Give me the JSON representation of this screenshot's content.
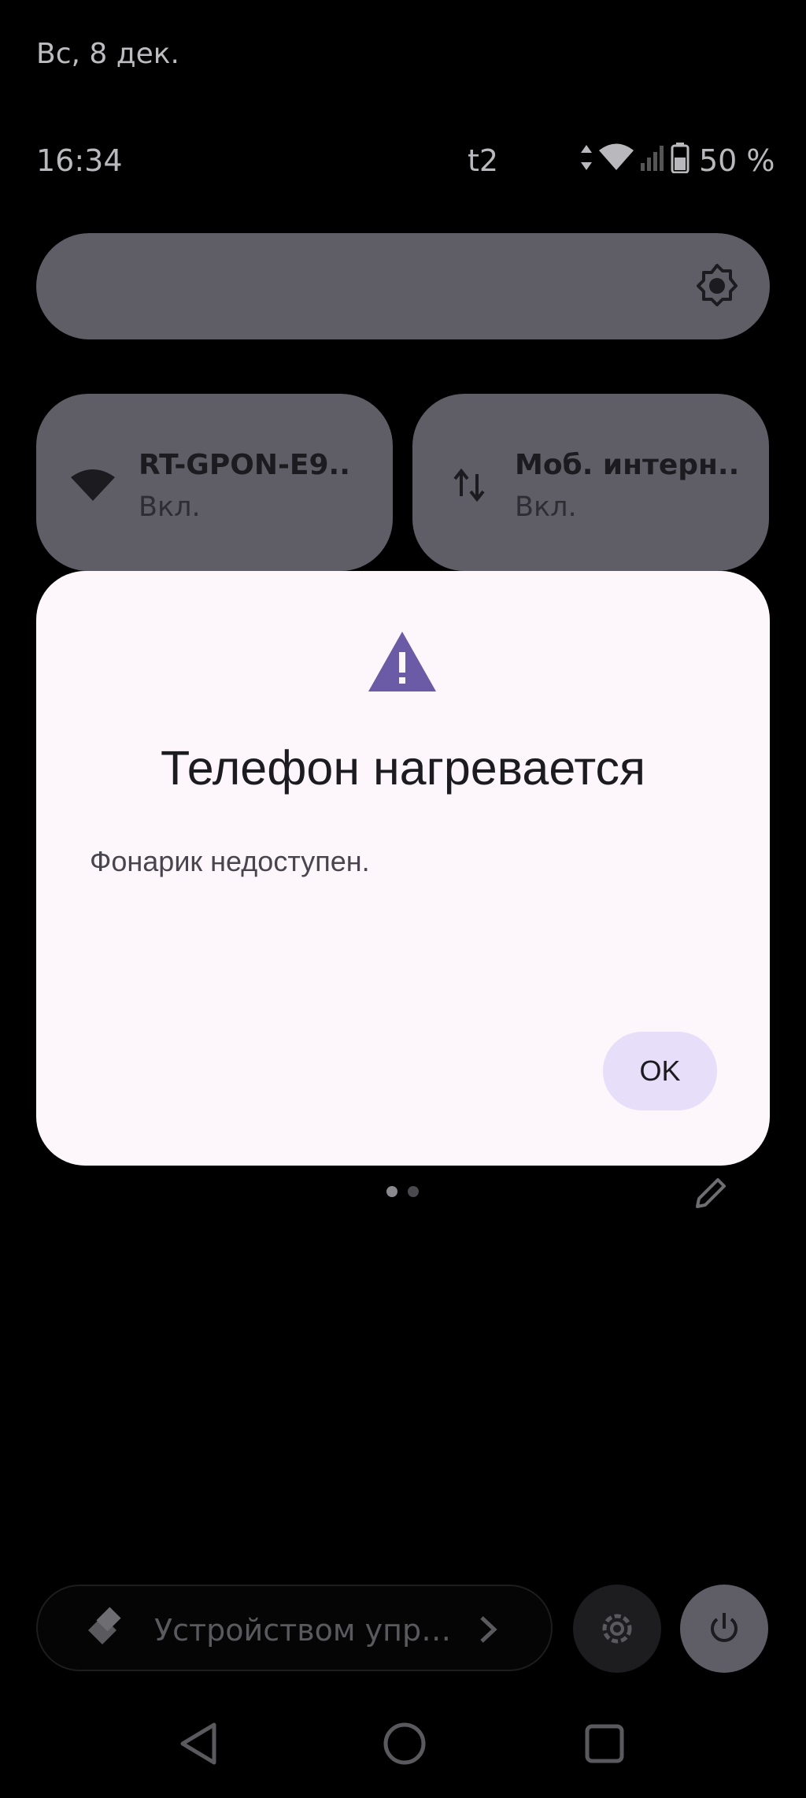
{
  "status_bar": {
    "date": "Вс, 8 дек.",
    "time": "16:34",
    "carrier": "t2",
    "battery": "50 %",
    "icons": [
      "data-arrows-icon",
      "wifi-icon",
      "cellular-signal-icon",
      "battery-icon"
    ]
  },
  "quick_settings": {
    "brightness_icon": "brightness-icon",
    "tiles": [
      {
        "title": "RT-GPON-E9..",
        "status": "Вкл.",
        "icon": "wifi-icon"
      },
      {
        "title": "Моб. интерн..",
        "status": "Вкл.",
        "icon": "mobile-data-icon"
      }
    ],
    "page_indicator": {
      "pages": 2,
      "current": 1
    },
    "edit_icon": "pencil-icon"
  },
  "dialog": {
    "icon": "warning-icon",
    "title": "Телефон нагревается",
    "body": "Фонарик недоступен.",
    "ok_label": "OK",
    "accent_color": "#6b5aa6"
  },
  "footer": {
    "device_control_label": "Устройством упр…",
    "device_control_icon": "device-control-icon",
    "settings_icon": "gear-icon",
    "power_icon": "power-icon"
  },
  "nav_bar": {
    "icons": [
      "back-icon",
      "home-icon",
      "recents-icon"
    ]
  }
}
